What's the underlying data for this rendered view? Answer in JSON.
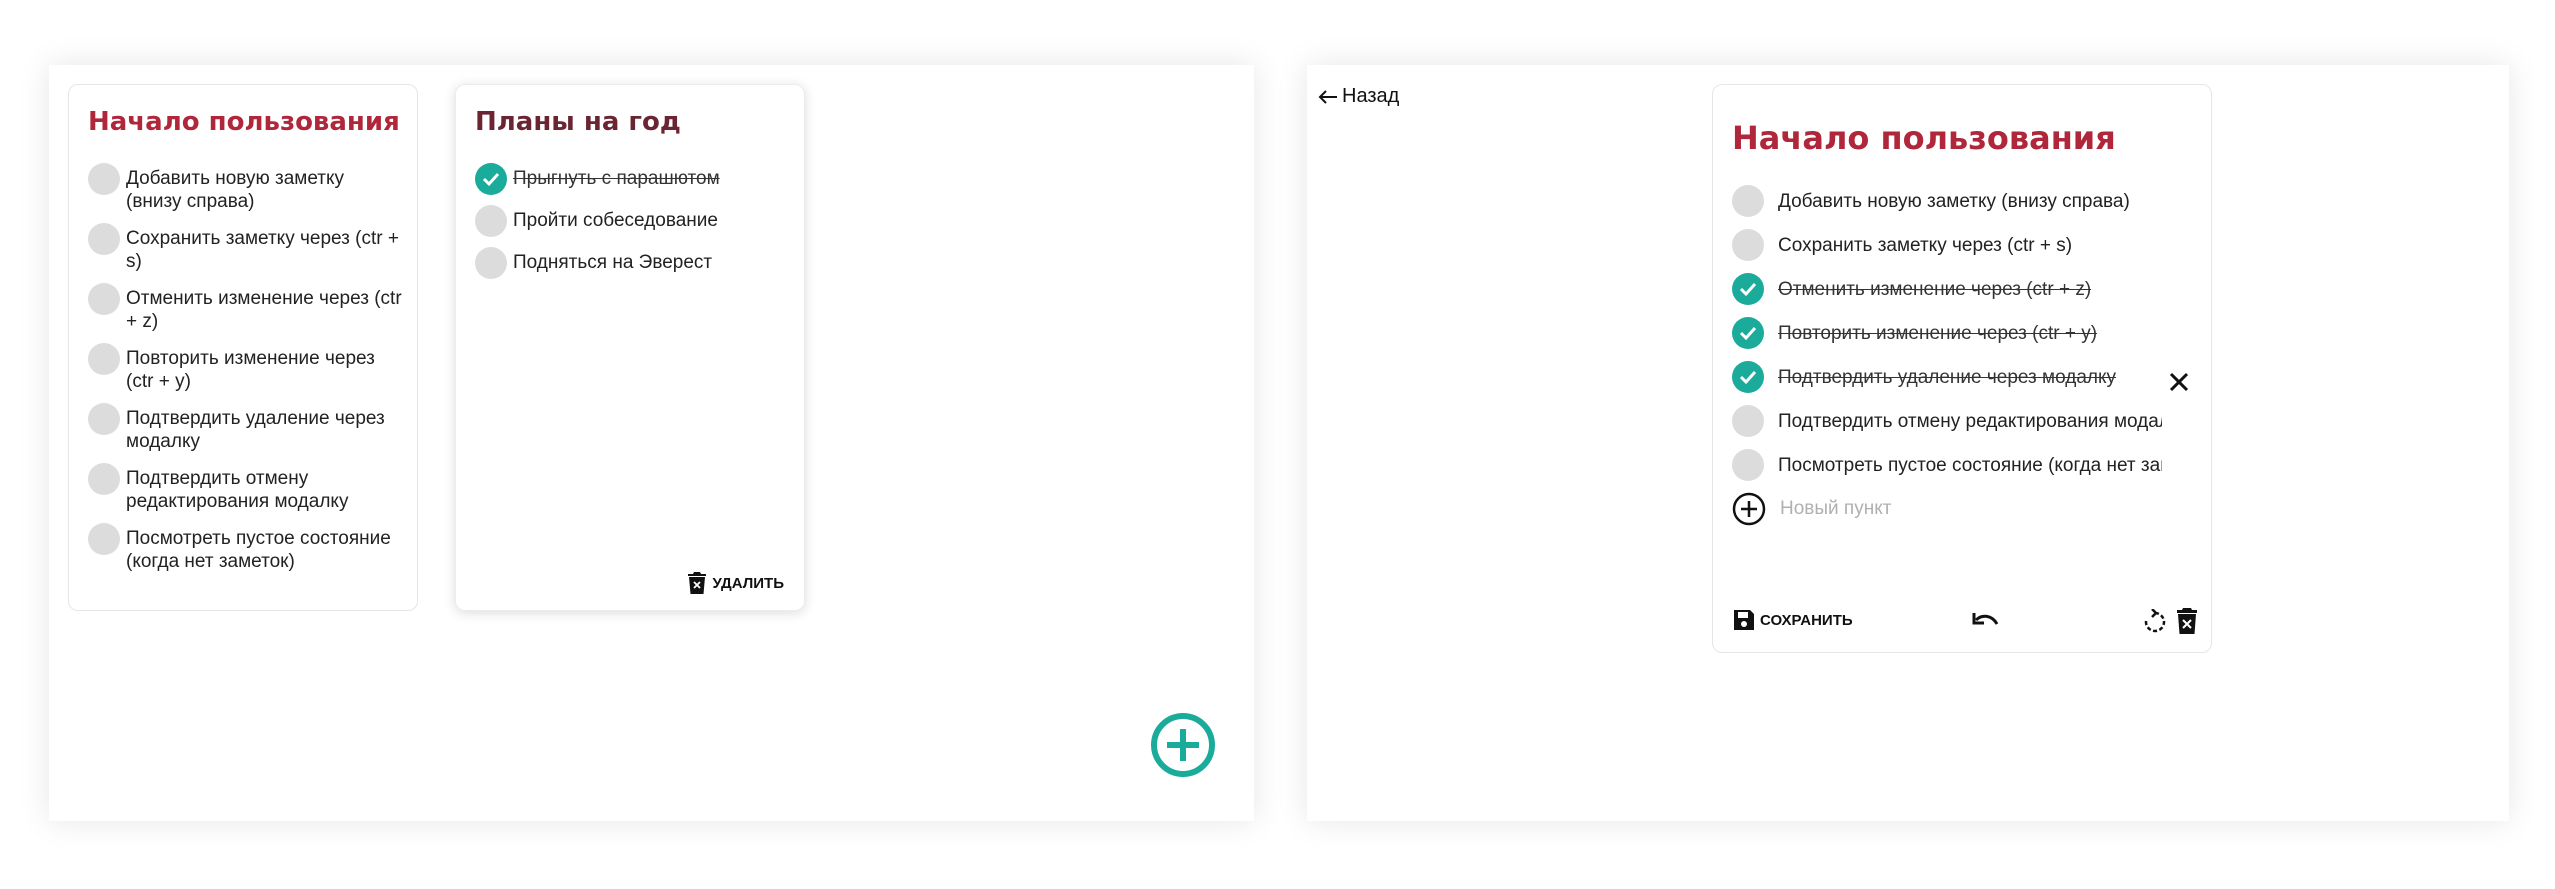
{
  "colors": {
    "accent_teal": "#1aab9b",
    "title_red": "#b0263a",
    "title_dark_red": "#6b2532"
  },
  "left_panel": {
    "notes": [
      {
        "title": "Начало пользования",
        "items": [
          {
            "text": "Добавить новую заметку (внизу справа)",
            "done": false
          },
          {
            "text": "Сохранить заметку через (ctr + s)",
            "done": false
          },
          {
            "text": "Отменить изменение через (ctr + z)",
            "done": false
          },
          {
            "text": "Повторить изменение через (ctr + y)",
            "done": false
          },
          {
            "text": "Подтвердить удаление через модалку",
            "done": false
          },
          {
            "text": "Подтвердить отмену редактирования модалку",
            "done": false
          },
          {
            "text": "Посмотреть пустое состояние (когда нет заметок)",
            "done": false
          }
        ]
      },
      {
        "title": "Планы на год",
        "items": [
          {
            "text": "Прыгнуть с парашютом",
            "done": true
          },
          {
            "text": "Пройти собеседование",
            "done": false
          },
          {
            "text": "Подняться на Эверест",
            "done": false
          }
        ],
        "delete_label": "УДАЛИТЬ"
      }
    ],
    "fab_icon": "add-circle-icon"
  },
  "right_panel": {
    "back_label": "Назад",
    "editor": {
      "title": "Начало пользования",
      "items": [
        {
          "text": "Добавить новую заметку (внизу справа)",
          "done": false
        },
        {
          "text": "Сохранить заметку через (ctr + s)",
          "done": false
        },
        {
          "text": "Отменить изменение через (ctr + z)",
          "done": true
        },
        {
          "text": "Повторить изменение через (ctr + y)",
          "done": true
        },
        {
          "text": "Подтвердить удаление через модалку",
          "done": true
        },
        {
          "text": "Подтвердить отмену редактирования модалку",
          "done": false
        },
        {
          "text": "Посмотреть пустое состояние (когда нет заметок)",
          "done": false
        }
      ],
      "new_item_placeholder": "Новый пункт",
      "new_item_value": "",
      "save_label": "СОХРАНИТЬ"
    }
  }
}
